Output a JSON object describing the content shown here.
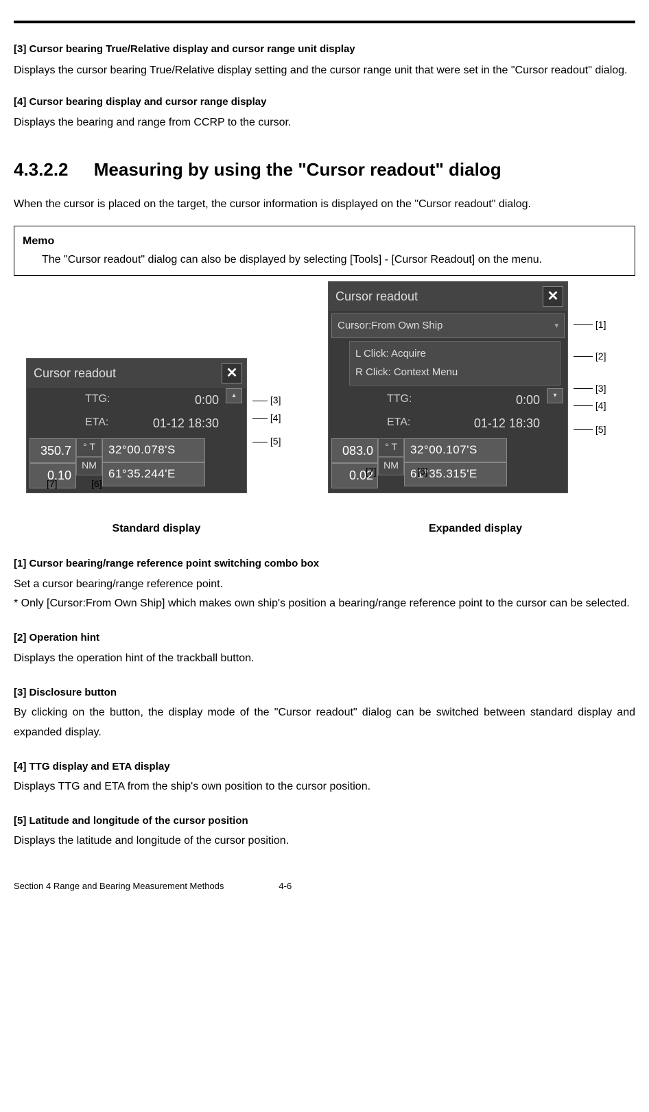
{
  "top": {
    "h3_title": "[3] Cursor bearing True/Relative display and cursor range unit display",
    "h3_body": "Displays the cursor bearing True/Relative display setting and the cursor range unit that were set in the \"Cursor readout\" dialog.",
    "h4_title": "[4] Cursor bearing display and cursor range display",
    "h4_body": "Displays the bearing and range from CCRP to the cursor."
  },
  "heading": {
    "num": "4.3.2.2",
    "title": "Measuring by using the \"Cursor readout\" dialog"
  },
  "intro": "When the cursor is placed on the target, the cursor information is displayed on the \"Cursor readout\" dialog.",
  "memo": {
    "label": "Memo",
    "text": "The \"Cursor readout\" dialog can also be displayed by selecting [Tools] - [Cursor Readout] on the menu."
  },
  "dialog_std": {
    "title": "Cursor readout",
    "ttg_label": "TTG:",
    "ttg_value": "0:00",
    "eta_label": "ETA:",
    "eta_value": "01-12 18:30",
    "bearing": "350.7",
    "range": "0.10",
    "deg_unit": "°  T",
    "range_unit": "NM",
    "lat": "32°00.078'S",
    "lon": "61°35.244'E",
    "caption": "Standard display"
  },
  "dialog_exp": {
    "title": "Cursor readout",
    "combo": "Cursor:From Own Ship",
    "hint1": "L Click: Acquire",
    "hint2": "R Click: Context Menu",
    "ttg_label": "TTG:",
    "ttg_value": "0:00",
    "eta_label": "ETA:",
    "eta_value": "01-12 18:30",
    "bearing": "083.0",
    "range": "0.02",
    "deg_unit": "°  T",
    "range_unit": "NM",
    "lat": "32°00.107'S",
    "lon": "61°35.315'E",
    "caption": "Expanded display"
  },
  "annot": {
    "a1": "[1]",
    "a2": "[2]",
    "a3": "[3]",
    "a4": "[4]",
    "a5": "[5]",
    "a6": "[6]",
    "a7": "[7]"
  },
  "items": {
    "i1_title": "[1] Cursor bearing/range reference point switching combo box",
    "i1_body": "Set a cursor bearing/range reference point.",
    "i1_note": "* Only [Cursor:From Own Ship] which makes own ship's position a bearing/range reference point to the cursor can be selected.",
    "i2_title": "[2] Operation hint",
    "i2_body": "Displays the operation hint of the trackball button.",
    "i3_title": "[3] Disclosure button",
    "i3_body": "By clicking on the button, the display mode of the \"Cursor readout\" dialog can be switched between standard display and expanded display.",
    "i4_title": "[4] TTG display and ETA display",
    "i4_body": "Displays TTG and ETA from the ship's own position to the cursor position.",
    "i5_title": "[5] Latitude and longitude of the cursor position",
    "i5_body": "Displays the latitude and longitude of the cursor position."
  },
  "footer": {
    "section": "Section 4    Range and Bearing Measurement Methods",
    "page": "4-6"
  }
}
